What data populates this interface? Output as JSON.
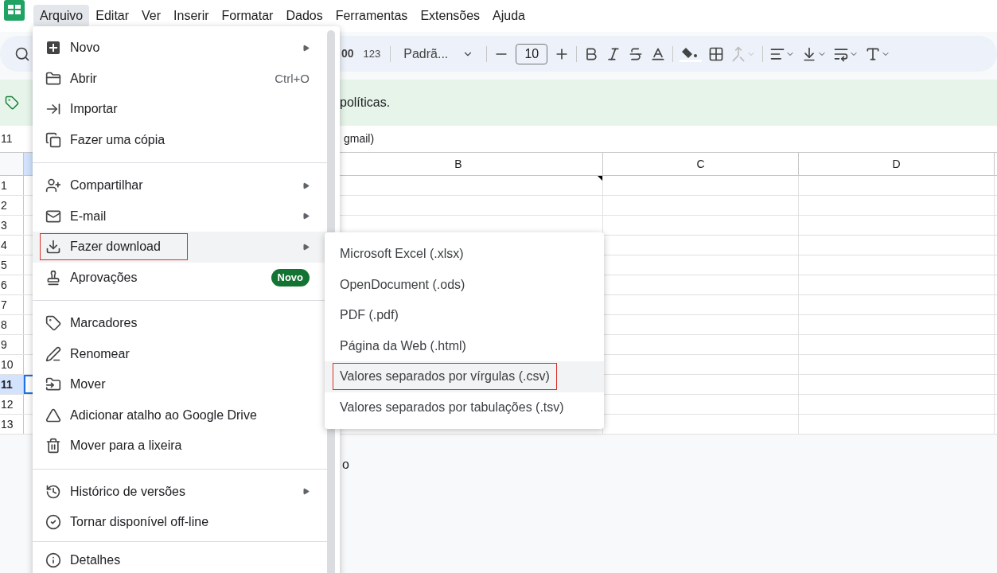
{
  "menubar": [
    {
      "label": "Arquivo",
      "selected": true
    },
    {
      "label": "Editar",
      "selected": false
    },
    {
      "label": "Ver",
      "selected": false
    },
    {
      "label": "Inserir",
      "selected": false
    },
    {
      "label": "Formatar",
      "selected": false
    },
    {
      "label": "Dados",
      "selected": false
    },
    {
      "label": "Ferramentas",
      "selected": false
    },
    {
      "label": "Extensões",
      "selected": false
    },
    {
      "label": "Ajuda",
      "selected": false
    }
  ],
  "toolbar": {
    "decimal": "00",
    "number_format": "123",
    "font": "Padrã...",
    "font_size": "10"
  },
  "banner": {
    "text": "políticas."
  },
  "formula_bar": {
    "cell_ref": "11",
    "content": "gmail)"
  },
  "grid": {
    "columns": [
      "B",
      "C",
      "D"
    ],
    "rows": [
      {
        "number": "1",
        "selected": false
      },
      {
        "number": "2",
        "selected": false
      },
      {
        "number": "3",
        "selected": false
      },
      {
        "number": "4",
        "selected": false
      },
      {
        "number": "5",
        "selected": false
      },
      {
        "number": "6",
        "selected": false
      },
      {
        "number": "7",
        "selected": false
      },
      {
        "number": "8",
        "selected": false
      },
      {
        "number": "9",
        "selected": false
      },
      {
        "number": "10",
        "selected": false
      },
      {
        "number": "11",
        "selected": true
      },
      {
        "number": "12",
        "selected": false
      },
      {
        "number": "13",
        "selected": false
      }
    ]
  },
  "sheet_tab": "o",
  "file_menu": [
    {
      "kind": "item",
      "label": "Novo",
      "submenu": true,
      "selected": false
    },
    {
      "kind": "item",
      "label": "Abrir",
      "shortcut": "Ctrl+O",
      "submenu": false,
      "selected": false
    },
    {
      "kind": "item",
      "label": "Importar",
      "submenu": false,
      "selected": false
    },
    {
      "kind": "item",
      "label": "Fazer uma cópia",
      "submenu": false,
      "selected": false
    },
    {
      "kind": "divider"
    },
    {
      "kind": "item",
      "label": "Compartilhar",
      "submenu": true,
      "selected": false
    },
    {
      "kind": "item",
      "label": "E-mail",
      "submenu": true,
      "selected": false
    },
    {
      "kind": "item",
      "label": "Fazer download",
      "submenu": true,
      "selected": true
    },
    {
      "kind": "item",
      "label": "Aprovações",
      "badge": "Novo",
      "submenu": false,
      "selected": false
    },
    {
      "kind": "divider"
    },
    {
      "kind": "item",
      "label": "Marcadores",
      "submenu": false,
      "selected": false
    },
    {
      "kind": "item",
      "label": "Renomear",
      "submenu": false,
      "selected": false
    },
    {
      "kind": "item",
      "label": "Mover",
      "submenu": false,
      "selected": false
    },
    {
      "kind": "item",
      "label": "Adicionar atalho ao Google Drive",
      "submenu": false,
      "selected": false
    },
    {
      "kind": "item",
      "label": "Mover para a lixeira",
      "submenu": false,
      "selected": false
    },
    {
      "kind": "divider"
    },
    {
      "kind": "item",
      "label": "Histórico de versões",
      "submenu": true,
      "selected": false
    },
    {
      "kind": "item",
      "label": "Tornar disponível off-line",
      "submenu": false,
      "selected": false
    },
    {
      "kind": "divider"
    },
    {
      "kind": "item",
      "label": "Detalhes",
      "submenu": false,
      "selected": false
    }
  ],
  "download_menu": [
    {
      "label": "Microsoft Excel (.xlsx)",
      "selected": false
    },
    {
      "label": "OpenDocument (.ods)",
      "selected": false
    },
    {
      "label": "PDF (.pdf)",
      "selected": false
    },
    {
      "label": "Página da Web (.html)",
      "selected": false
    },
    {
      "label": "Valores separados por vírgulas (.csv)",
      "selected": true
    },
    {
      "label": "Valores separados por tabulações (.tsv)",
      "selected": false
    }
  ]
}
